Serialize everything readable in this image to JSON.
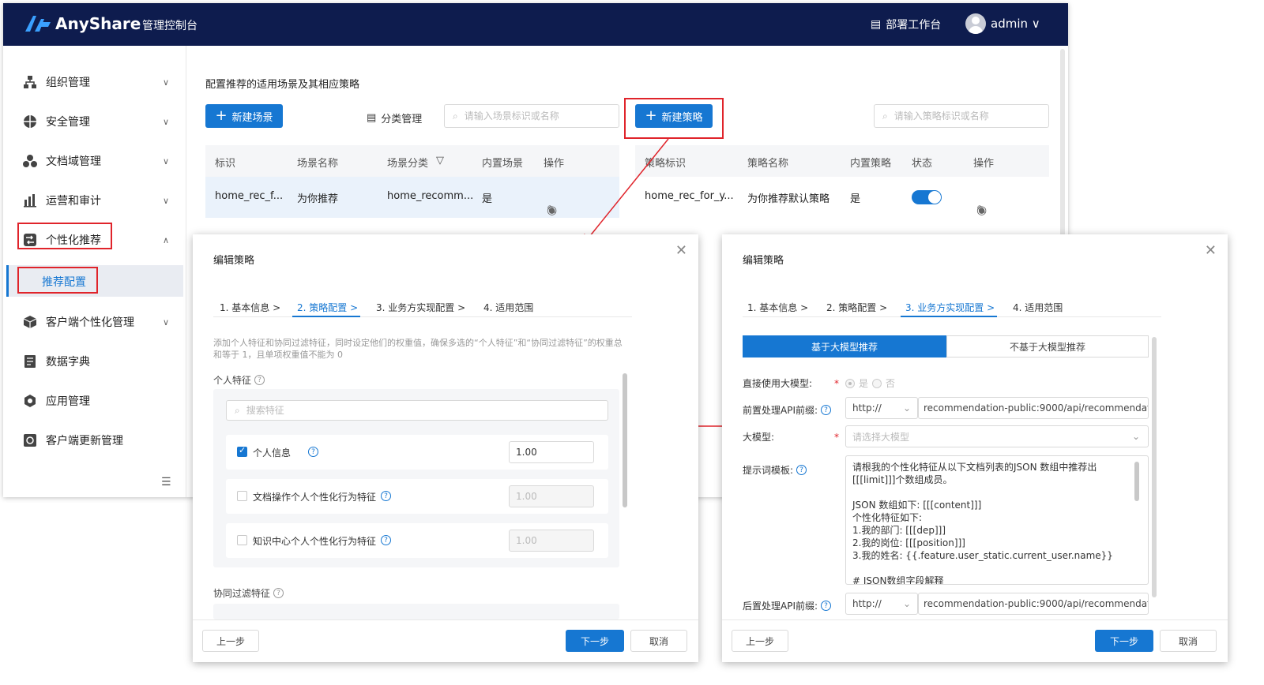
{
  "header": {
    "brand": "AnyShare",
    "console_title": "管理控制台",
    "deploy_label": "部署工作台",
    "user": "admin"
  },
  "sidebar": {
    "items": [
      {
        "label": "组织管理",
        "icon": "org-icon"
      },
      {
        "label": "安全管理",
        "icon": "shield-icon"
      },
      {
        "label": "文档域管理",
        "icon": "domain-icon"
      },
      {
        "label": "运营和审计",
        "icon": "chart-icon"
      },
      {
        "label": "个性化推荐",
        "icon": "recommend-icon"
      },
      {
        "label": "客户端个性化管理",
        "icon": "cube-icon"
      },
      {
        "label": "数据字典",
        "icon": "book-icon"
      },
      {
        "label": "应用管理",
        "icon": "app-icon"
      },
      {
        "label": "客户端更新管理",
        "icon": "update-icon"
      }
    ],
    "sub_item": "推荐配置"
  },
  "content": {
    "title": "配置推荐的适用场景及其相应策略",
    "new_scene": "新建场景",
    "category_mgmt": "分类管理",
    "scene_search_placeholder": "请输入场景标识或名称",
    "new_strategy": "新建策略",
    "strategy_search_placeholder": "请输入策略标识或名称",
    "scene_table": {
      "headers": [
        "标识",
        "场景名称",
        "场景分类",
        "内置场景",
        "操作"
      ],
      "row": [
        "home_rec_f...",
        "为你推荐",
        "home_recomm...",
        "是"
      ]
    },
    "strategy_table": {
      "headers": [
        "策略标识",
        "策略名称",
        "内置策略",
        "状态",
        "操作"
      ],
      "row": [
        "home_rec_for_y...",
        "为你推荐默认策略",
        "是"
      ]
    }
  },
  "dialog_left": {
    "title": "编辑策略",
    "steps": [
      "1. 基本信息 >",
      "2. 策略配置 >",
      "3. 业务方实现配置 >",
      "4. 适用范围"
    ],
    "hint": "添加个人特征和协同过滤特征，同时设定他们的权重值，确保多选的“个人特征”和“协同过滤特征”的权重总和等于 1，且单项权重值不能为 0",
    "personal_label": "个人特征",
    "search_placeholder": "搜索特征",
    "features": [
      {
        "label": "个人信息",
        "weight": "1.00",
        "checked": true
      },
      {
        "label": "文档操作个人个性化行为特征",
        "weight": "1.00",
        "checked": false
      },
      {
        "label": "知识中心个人个性化行为特征",
        "weight": "1.00",
        "checked": false
      }
    ],
    "collab_label": "协同过滤特征",
    "prev": "上一步",
    "next": "下一步",
    "cancel": "取消"
  },
  "dialog_right": {
    "title": "编辑策略",
    "steps": [
      "1. 基本信息 >",
      "2. 策略配置 >",
      "3. 业务方实现配置 >",
      "4. 适用范围"
    ],
    "tab_llm": "基于大模型推荐",
    "tab_non_llm": "不基于大模型推荐",
    "direct_llm_label": "直接使用大模型:",
    "yes": "是",
    "no": "否",
    "pre_api_label": "前置处理API前缀:",
    "protocol": "http://",
    "pre_api_value": "recommendation-public:9000/api/recommendat",
    "model_label": "大模型:",
    "model_placeholder": "请选择大模型",
    "prompt_label": "提示词模板:",
    "prompt_text": "请根我的个性化特征从以下文档列表的JSON 数组中推荐出\n[[[limit]]]个数组成员。\n\nJSON 数组如下: [[[content]]]\n个性化特征如下:\n1.我的部门: [[[dep]]]\n2.我的岗位: [[[position]]]\n3.我的姓名: {{.feature.user_static.current_user.name}}\n\n# JSON数组字段解释",
    "post_api_label": "后置处理API前缀:",
    "post_api_value": "recommendation-public:9000/api/recommendat",
    "prev": "上一步",
    "next": "下一步",
    "cancel": "取消"
  },
  "colors": {
    "header_bg": "#0e1c4e",
    "primary": "#1677d2",
    "highlight_red": "#e0242b"
  }
}
